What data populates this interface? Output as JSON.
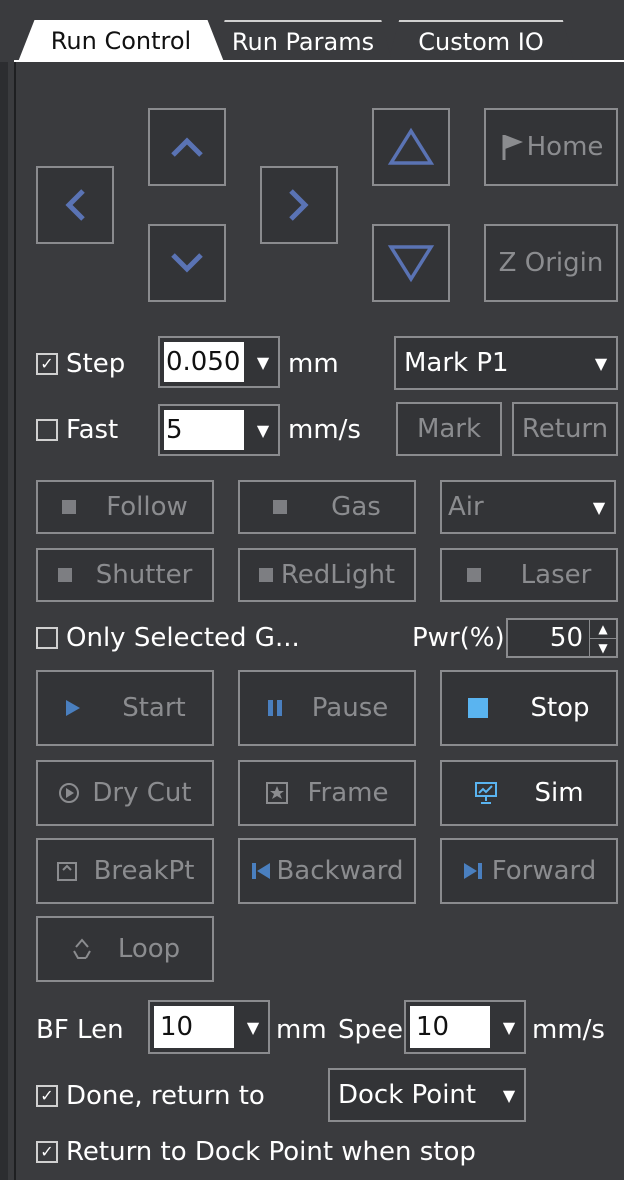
{
  "tabs": [
    {
      "label": "Run Control"
    },
    {
      "label": "Run Params"
    },
    {
      "label": "Custom IO"
    }
  ],
  "jog": {
    "home_label": "Home",
    "zorigin_label": "Z Origin"
  },
  "step": {
    "label": "Step",
    "checked": true,
    "value": "0.050",
    "unit": "mm"
  },
  "fast": {
    "label": "Fast",
    "checked": false,
    "value": "5",
    "unit": "mm/s"
  },
  "mark": {
    "point_value": "Mark P1",
    "mark_label": "Mark",
    "return_label": "Return"
  },
  "toggles": {
    "follow": "Follow",
    "gas": "Gas",
    "gas_type": "Air",
    "shutter": "Shutter",
    "redlight": "RedLight",
    "laser": "Laser"
  },
  "only_selected": {
    "label": "Only Selected G...",
    "checked": false
  },
  "power": {
    "label": "Pwr(%)",
    "value": "50"
  },
  "run": {
    "start": "Start",
    "pause": "Pause",
    "stop": "Stop",
    "dry_cut": "Dry Cut",
    "frame": "Frame",
    "sim": "Sim",
    "breakpt": "BreakPt",
    "backward": "Backward",
    "forward": "Forward",
    "loop": "Loop"
  },
  "bf": {
    "len_label": "BF Len",
    "len_value": "10",
    "len_unit": "mm",
    "speed_label": "Spee",
    "speed_value": "10",
    "speed_unit": "mm/s"
  },
  "done": {
    "label": "Done, return to",
    "checked": true,
    "target": "Dock Point"
  },
  "return_dock": {
    "label": "Return to Dock Point when stop",
    "checked": true
  },
  "colors": {
    "background": "#3a3b3e",
    "arrow": "#5a73b4",
    "disabled_text": "#8b8c8f",
    "active_text": "#ffffff",
    "stop_square": "#5ab4f0"
  }
}
